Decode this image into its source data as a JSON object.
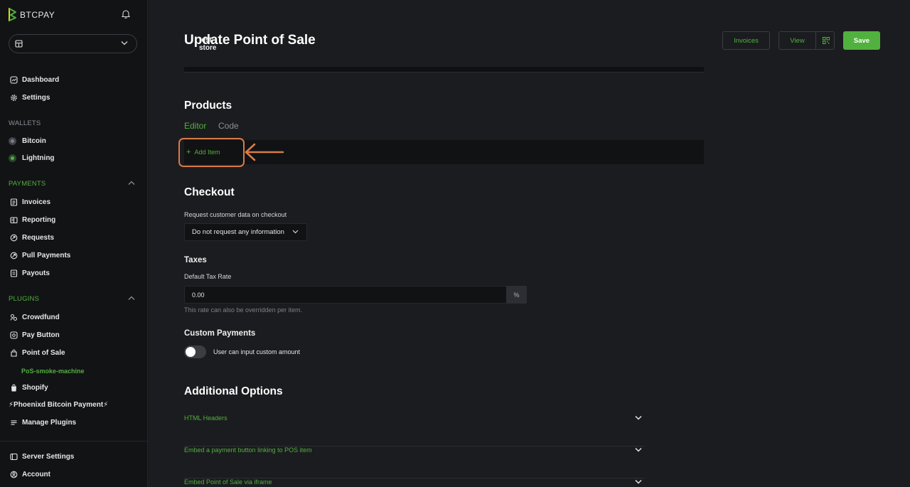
{
  "brand": {
    "name": "BTCPAY",
    "accent": "#51b13e",
    "annotation_color": "#d87b47"
  },
  "store": {
    "name": "test-store"
  },
  "sidebar": {
    "main": [
      {
        "label": "Dashboard",
        "icon": "dashboard-icon"
      },
      {
        "label": "Settings",
        "icon": "gear-icon"
      }
    ],
    "wallets_heading": "WALLETS",
    "wallets": [
      {
        "label": "Bitcoin",
        "status": "inactive"
      },
      {
        "label": "Lightning",
        "status": "active"
      }
    ],
    "payments_heading": "PAYMENTS",
    "payments": [
      {
        "label": "Invoices",
        "icon": "invoice-icon"
      },
      {
        "label": "Reporting",
        "icon": "reporting-icon"
      },
      {
        "label": "Requests",
        "icon": "requests-icon"
      },
      {
        "label": "Pull Payments",
        "icon": "pull-payments-icon"
      },
      {
        "label": "Payouts",
        "icon": "payouts-icon"
      }
    ],
    "plugins_heading": "PLUGINS",
    "plugins": [
      {
        "label": "Crowdfund",
        "icon": "crowdfund-icon"
      },
      {
        "label": "Pay Button",
        "icon": "pay-button-icon"
      },
      {
        "label": "Point of Sale",
        "icon": "point-of-sale-icon"
      }
    ],
    "pos_subitem": "PoS-smoke-machine",
    "plugins_more": [
      {
        "label": "Shopify",
        "icon": "shopify-icon"
      },
      {
        "label": "⚡Phoenixd Bitcoin Payment⚡",
        "icon": ""
      },
      {
        "label": "Manage Plugins",
        "icon": "manage-plugins-icon"
      }
    ],
    "footer": [
      {
        "label": "Server Settings",
        "icon": "server-icon"
      },
      {
        "label": "Account",
        "icon": "account-icon"
      }
    ]
  },
  "header": {
    "title": "Update Point of Sale",
    "invoices_label": "Invoices",
    "view_label": "View",
    "save_label": "Save"
  },
  "products": {
    "heading": "Products",
    "tabs": [
      "Editor",
      "Code"
    ],
    "add_item_label": "Add Item"
  },
  "checkout": {
    "heading": "Checkout",
    "request_label": "Request customer data on checkout",
    "request_value": "Do not request any information"
  },
  "taxes": {
    "heading": "Taxes",
    "rate_label": "Default Tax Rate",
    "rate_value": "0.00",
    "rate_unit": "%",
    "hint": "This rate can also be overridden per item."
  },
  "custom_payments": {
    "heading": "Custom Payments",
    "toggle_label": "User can input custom amount",
    "enabled": false
  },
  "additional": {
    "heading": "Additional Options",
    "items": [
      "HTML Headers",
      "Embed a payment button linking to POS item",
      "Embed Point of Sale via iframe"
    ]
  }
}
